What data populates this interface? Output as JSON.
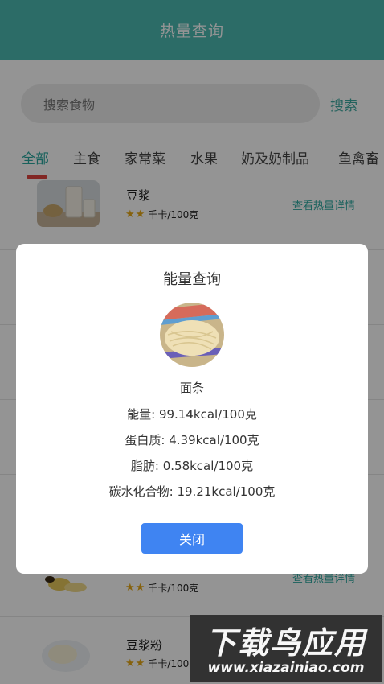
{
  "header": {
    "title": "热量查询"
  },
  "search": {
    "placeholder": "搜索食物",
    "button": "搜索"
  },
  "tabs": [
    {
      "label": "全部",
      "active": true
    },
    {
      "label": "主食"
    },
    {
      "label": "家常菜"
    },
    {
      "label": "水果"
    },
    {
      "label": "奶及奶制品"
    },
    {
      "label": "鱼禽畜"
    }
  ],
  "foods": [
    {
      "name": "豆浆",
      "stars": 2,
      "unit": "千卡/100克",
      "link": "查看热量详情"
    },
    {
      "name": "",
      "stars": 2,
      "unit": "千卡/100克",
      "link": "查看热量详情"
    },
    {
      "name": "豆浆粉",
      "stars": 2,
      "unit": "千卡/100",
      "link": ""
    }
  ],
  "dialog": {
    "title": "能量查询",
    "food": "面条",
    "energy": "能量: 99.14kcal/100克",
    "protein": "蛋白质: 4.39kcal/100克",
    "fat": "脂肪: 0.58kcal/100克",
    "carbs": "碳水化合物: 19.21kcal/100克",
    "close": "关闭"
  },
  "watermark": {
    "cn": "下载鸟应用",
    "en": "www.xiazainiao.com"
  },
  "colors": {
    "primary": "#4dbab2",
    "accent": "#2aa89f",
    "indicator": "#e0443e",
    "button": "#3f84f2",
    "star": "#e6a817"
  }
}
